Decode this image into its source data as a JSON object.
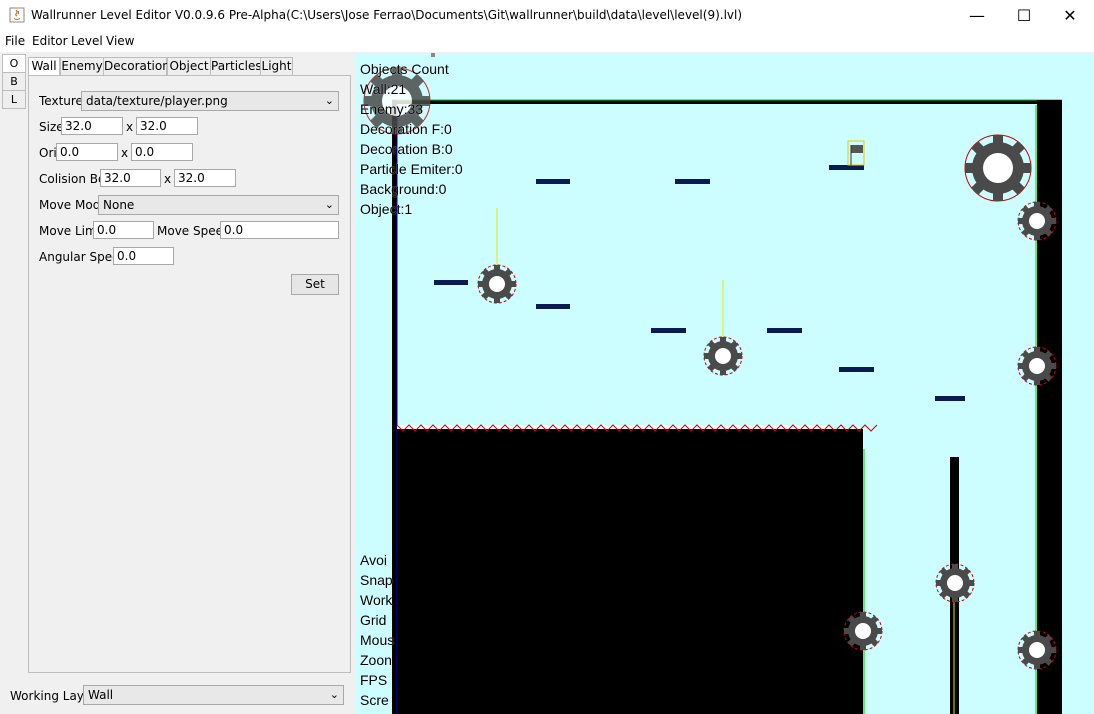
{
  "window": {
    "title": "Wallrunner Level Editor V0.0.9.6 Pre-Alpha(C:\\Users\\Jose Ferrao\\Documents\\Git\\wallrunner\\build\\data\\level\\level(9).lvl)",
    "minimize": "—",
    "maximize": "☐",
    "close": "✕"
  },
  "menu": [
    "File",
    "Editor",
    "Level",
    "View"
  ],
  "side_tabs": [
    "O",
    "B",
    "L"
  ],
  "tabs": [
    "Wall",
    "Enemy",
    "Decoration",
    "Object",
    "Particles",
    "Light"
  ],
  "form": {
    "texture_label": "Texture",
    "texture_value": "data/texture/player.png",
    "size_label": "Size",
    "size_w": "32.0",
    "size_h": "32.0",
    "x": "x",
    "ori_label": "Ori",
    "ori_x": "0.0",
    "ori_y": "0.0",
    "colision_label": "Colision Box",
    "colision_w": "32.0",
    "colision_h": "32.0",
    "move_mode_label": "Move Mode",
    "move_mode_value": "None",
    "move_limit_label": "Move Limit",
    "move_limit_value": "0.0",
    "move_speed_label": "Move Speed",
    "move_speed_value": "0.0",
    "angular_speed_label": "Angular Speed",
    "angular_speed_value": "0.0",
    "set_button": "Set"
  },
  "working_layer": {
    "label": "Working Layer",
    "value": "Wall"
  },
  "stats": {
    "lines": [
      "Objects Count",
      "Wall:21",
      "Enemy:33",
      "Decoration F:0",
      "Decoration B:0",
      "Particle Emiter:0",
      "Background:0",
      "Object:1"
    ]
  },
  "status": {
    "lines": [
      "Avoi",
      "Snap",
      "Work",
      "Grid",
      "Mous",
      "Zoon",
      "FPS",
      "Scre"
    ]
  },
  "colors": {
    "canvas_bg": "#ccfeff",
    "wall": "#000000",
    "platform": "#0b1a50",
    "gear": "#4a4a4a",
    "gear_outline": "#cc0000",
    "laser": "#e8e800",
    "spikes": "#cc0000",
    "border_green": "#00cc00"
  }
}
